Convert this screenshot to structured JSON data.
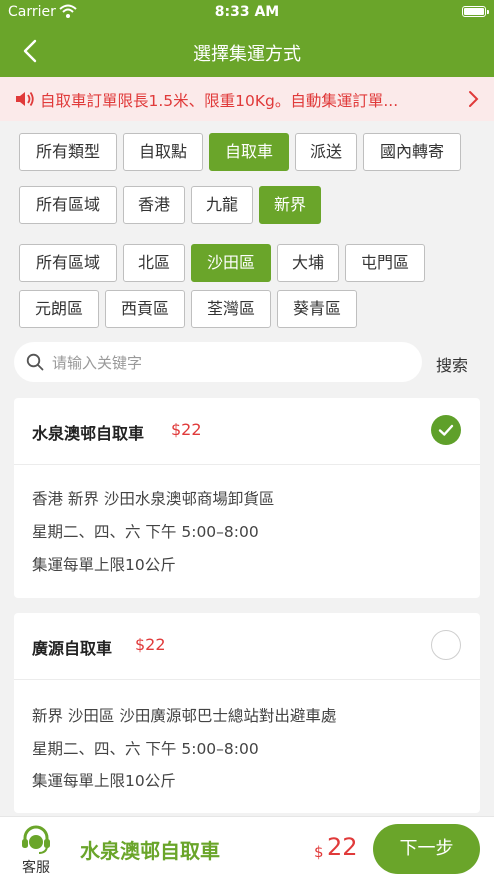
{
  "status": {
    "carrier": "Carrier",
    "time": "8:33 AM"
  },
  "nav": {
    "title": "選擇集運方式"
  },
  "notice": {
    "text": "自取車訂單限長1.5米、限重10Kg。自動集運訂單..."
  },
  "filters": {
    "types": [
      "所有類型",
      "自取點",
      "自取車",
      "派送",
      "國內轉寄"
    ],
    "regions": [
      "所有區域",
      "香港",
      "九龍",
      "新界"
    ],
    "districts": [
      "所有區域",
      "北區",
      "沙田區",
      "大埔",
      "屯門區",
      "元朗區",
      "西貢區",
      "荃灣區",
      "葵青區"
    ]
  },
  "search": {
    "placeholder": "请输入关键字",
    "button": "搜索"
  },
  "options": [
    {
      "name": "水泉澳邨自取車",
      "price": "$22",
      "address": "香港 新界 沙田水泉澳邨商場卸貨區",
      "hours": "星期二、四、六 下午 5:00–8:00",
      "limit": "集運每單上限10公斤",
      "selected": true
    },
    {
      "name": "廣源自取車",
      "price": "$22",
      "address": "新界 沙田區 沙田廣源邨巴士總站對出避車處",
      "hours": "星期二、四、六 下午 5:00–8:00",
      "limit": "集運每單上限10公斤",
      "selected": false
    }
  ],
  "bottom": {
    "service_label": "客服",
    "selected_name": "水泉澳邨自取車",
    "currency": "$",
    "amount": "22",
    "next": "下一步"
  },
  "colors": {
    "brand": "#6aa52a",
    "accent_red": "#e03a3a",
    "notice_bg": "#fbeaea"
  },
  "icons": [
    "back-arrow-icon",
    "wifi-icon",
    "battery-icon",
    "speaker-icon",
    "chevron-right-icon",
    "search-icon",
    "check-icon",
    "headset-icon"
  ]
}
